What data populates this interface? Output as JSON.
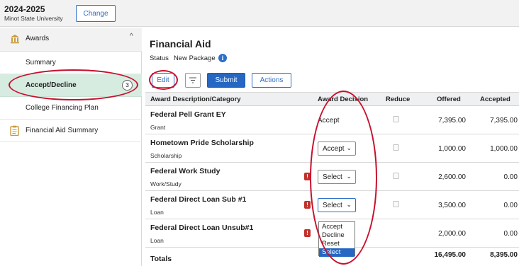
{
  "header": {
    "year": "2024-2025",
    "school": "Minot State University",
    "change_label": "Change"
  },
  "sidebar": {
    "section_label": "Awards",
    "items": [
      {
        "label": "Summary"
      },
      {
        "label": "Accept/Decline",
        "badge": "3"
      },
      {
        "label": "College Financing Plan"
      }
    ],
    "fa_summary_label": "Financial Aid Summary"
  },
  "main": {
    "title": "Financial Aid",
    "status_label": "Status",
    "status_value": "New Package",
    "toolbar": {
      "edit_label": "Edit",
      "submit_label": "Submit",
      "actions_label": "Actions"
    },
    "columns": [
      "Award Description/Category",
      "Award Decision",
      "Reduce",
      "Offered",
      "Accepted"
    ],
    "rows": [
      {
        "desc": "Federal Pell Grant EY",
        "category": "Grant",
        "decision": "Accept",
        "offered": "7,395.00",
        "accepted": "7,395.00"
      },
      {
        "desc": "Hometown Pride Scholarship",
        "category": "Scholarship",
        "decision": "Accept",
        "offered": "1,000.00",
        "accepted": "1,000.00"
      },
      {
        "desc": "Federal Work Study",
        "category": "Work/Study",
        "decision": "Select",
        "offered": "2,600.00",
        "accepted": "0.00"
      },
      {
        "desc": "Federal Direct Loan Sub #1",
        "category": "Loan",
        "decision": "Select",
        "offered": "3,500.00",
        "accepted": "0.00"
      },
      {
        "desc": "Federal Direct Loan Unsub#1",
        "category": "Loan",
        "decision": "",
        "offered": "2,000.00",
        "accepted": "0.00"
      }
    ],
    "dropdown_options": [
      "Accept",
      "Decline",
      "Reset",
      "Select"
    ],
    "totals": {
      "label": "Totals",
      "offered": "16,495.00",
      "accepted": "8,395.00"
    }
  },
  "colors": {
    "accent": "#2567c2",
    "selected_nav": "#d7ece1",
    "annotation": "#c8102e",
    "warning": "#c0312b"
  },
  "icons": {
    "awards": "bank-icon",
    "fa_summary": "clipboard-icon",
    "info": "info-icon",
    "warning": "warning-icon",
    "filter": "filter-icon"
  }
}
